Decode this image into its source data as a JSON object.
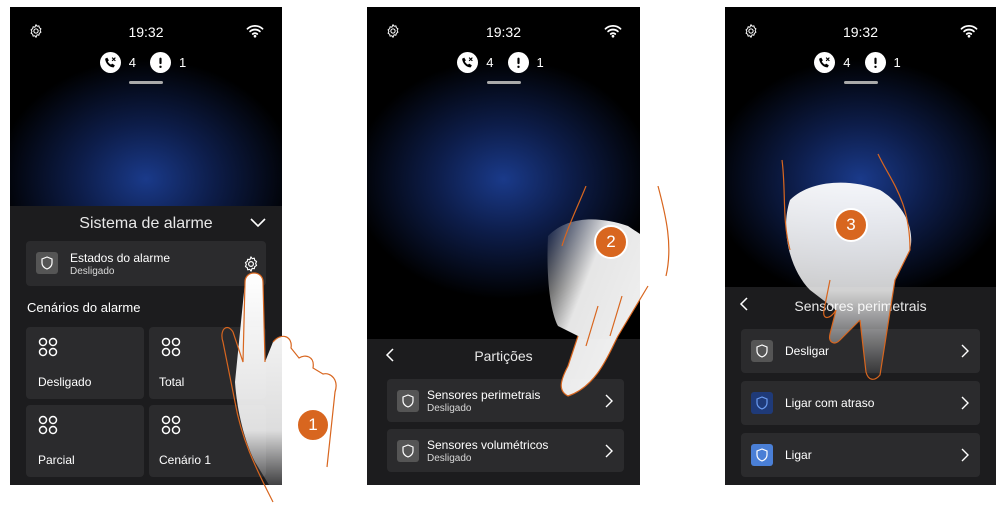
{
  "status": {
    "time": "19:32",
    "missed_calls": "4",
    "alerts": "1"
  },
  "screen1": {
    "panel_title": "Sistema de alarme",
    "state_card": {
      "title": "Estados do alarme",
      "subtitle": "Desligado"
    },
    "section_label": "Cenários do alarme",
    "scenarios": [
      {
        "label": "Desligado"
      },
      {
        "label": "Total"
      },
      {
        "label": "Parcial"
      },
      {
        "label": "Cenário 1"
      }
    ],
    "step": "1"
  },
  "screen2": {
    "panel_title": "Partições",
    "items": [
      {
        "title": "Sensores perimetrais",
        "subtitle": "Desligado"
      },
      {
        "title": "Sensores volumétricos",
        "subtitle": "Desligado"
      }
    ],
    "step": "2"
  },
  "screen3": {
    "panel_title": "Sensores perimetrais",
    "items": [
      {
        "label": "Desligar",
        "icon_color": "#555555"
      },
      {
        "label": "Ligar com atraso",
        "icon_color": "#1f3a78"
      },
      {
        "label": "Ligar",
        "icon_color": "#4a7fd6"
      }
    ],
    "step": "3"
  },
  "colors": {
    "step_badge": "#d8661f",
    "hand_outline": "#d8661f",
    "panel_bg": "#1c1c1e"
  },
  "icons": [
    "settings-gear-icon",
    "wifi-icon",
    "missed-call-icon",
    "alert-icon",
    "shield-icon",
    "chevron-right-icon",
    "chevron-left-icon",
    "chevron-down-icon",
    "scenario-icon"
  ]
}
